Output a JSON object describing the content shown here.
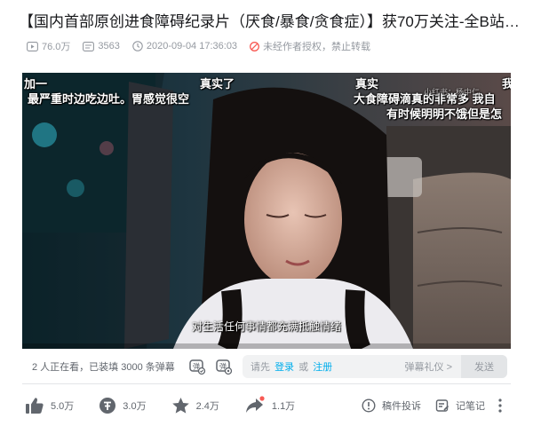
{
  "video": {
    "title": "【国内首部原创进食障碍纪录片（厌食/暴食/贪食症）】获70万关注-全B站…",
    "views": "76.0万",
    "danmaku_count": "3563",
    "publish_time": "2020-09-04 17:36:03",
    "copyright_notice": "未经作者授权，禁止转载"
  },
  "player": {
    "danmaku": [
      "加一",
      "最严重时边吃边吐。胃感觉很空",
      "真实了",
      "真实",
      "我",
      "大食障碍滴真的非常多 我自",
      "有时候明明不饿但是怎",
      "小红书：杨中仁"
    ],
    "subtitle": "对生活任何事情都充满抵触情绪"
  },
  "danmaku_bar": {
    "watching_text": "2 人正在看，已装填 3000 条弹幕",
    "input_prefix": "请先",
    "login_link": "登录",
    "or_text": "或",
    "register_link": "注册",
    "etiquette_label": "弹幕礼仪 >",
    "send_label": "发送"
  },
  "toolbar": {
    "like_count": "5.0万",
    "coin_count": "3.0万",
    "favorite_count": "2.4万",
    "share_count": "1.1万",
    "report_label": "稿件投诉",
    "notes_label": "记笔记"
  },
  "colors": {
    "accent": "#00aeec",
    "muted": "#9499a0",
    "icon": "#61666d",
    "notice": "#f85a54"
  }
}
